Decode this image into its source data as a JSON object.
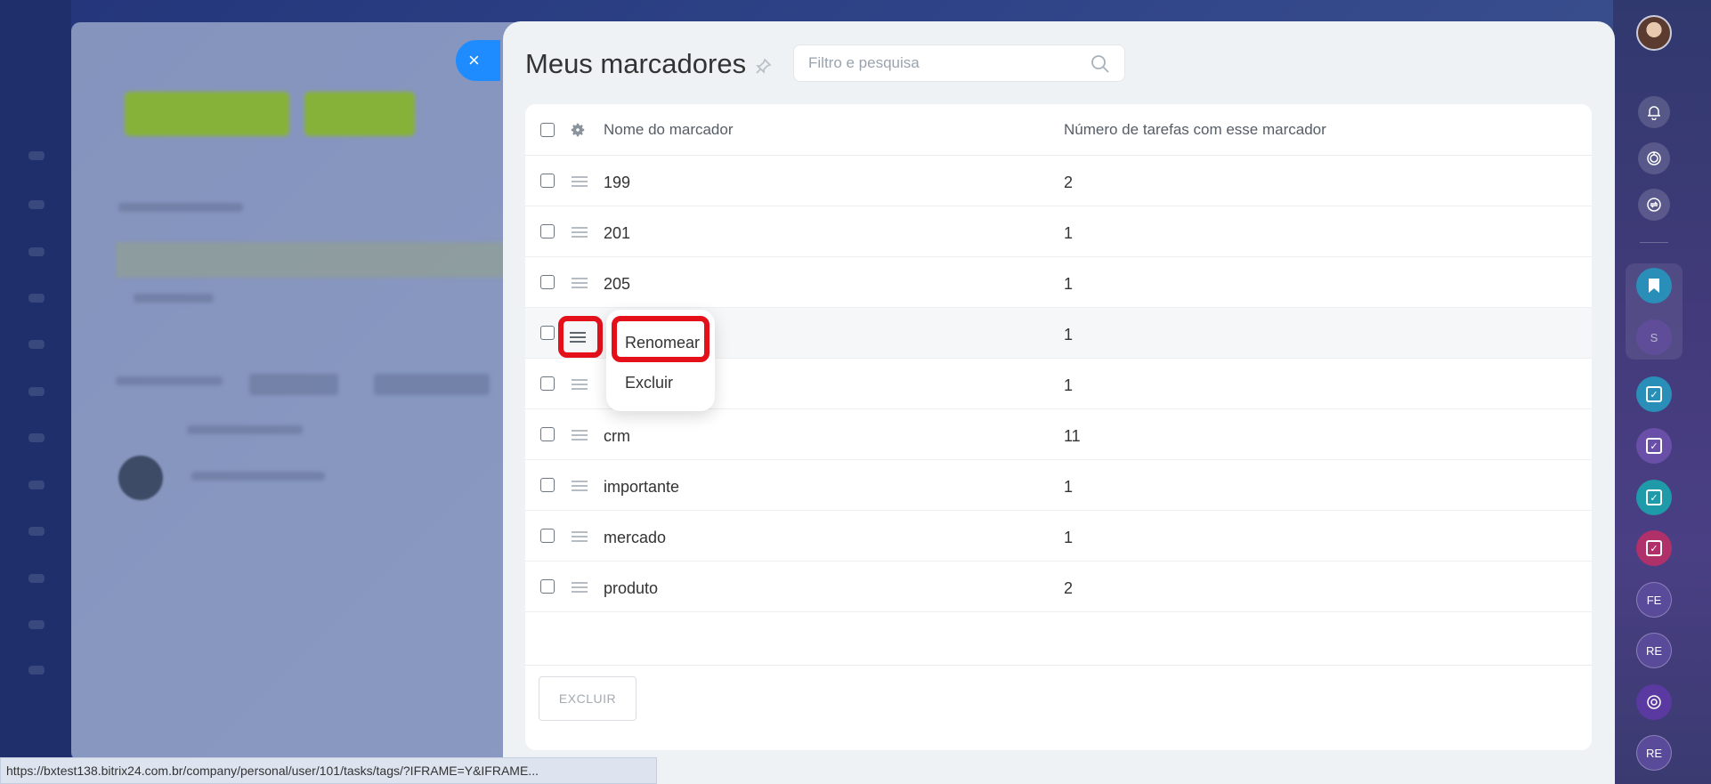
{
  "panel": {
    "title": "Meus marcadores",
    "search_placeholder": "Filtro e pesquisa",
    "close_icon": "×"
  },
  "table": {
    "headers": {
      "name": "Nome do marcador",
      "count": "Número de tarefas com esse marcador"
    },
    "rows": [
      {
        "name": "199",
        "count": "2"
      },
      {
        "name": "201",
        "count": "1"
      },
      {
        "name": "205",
        "count": "1"
      },
      {
        "name": "",
        "count": "1"
      },
      {
        "name": "",
        "count": "1"
      },
      {
        "name": "crm",
        "count": "11"
      },
      {
        "name": "importante",
        "count": "1"
      },
      {
        "name": "mercado",
        "count": "1"
      },
      {
        "name": "produto",
        "count": "2"
      }
    ]
  },
  "context_menu": {
    "rename": "Renomear",
    "delete": "Excluir"
  },
  "footer": {
    "delete_button": "EXCLUIR"
  },
  "status_bar": {
    "url": "https://bxtest138.bitrix24.com.br/company/personal/user/101/tasks/tags/?IFRAME=Y&IFRAME..."
  },
  "right_sidebar": {
    "badges": [
      "S",
      "FE",
      "RE",
      "RE"
    ],
    "colors": {
      "blue_app": "#2a8fb8",
      "purple_app": "#6a4fa8",
      "teal_app": "#1e9aa8",
      "pink_app": "#b0306a",
      "accent": "#1e8cff",
      "highlight": "#e4111b"
    }
  }
}
